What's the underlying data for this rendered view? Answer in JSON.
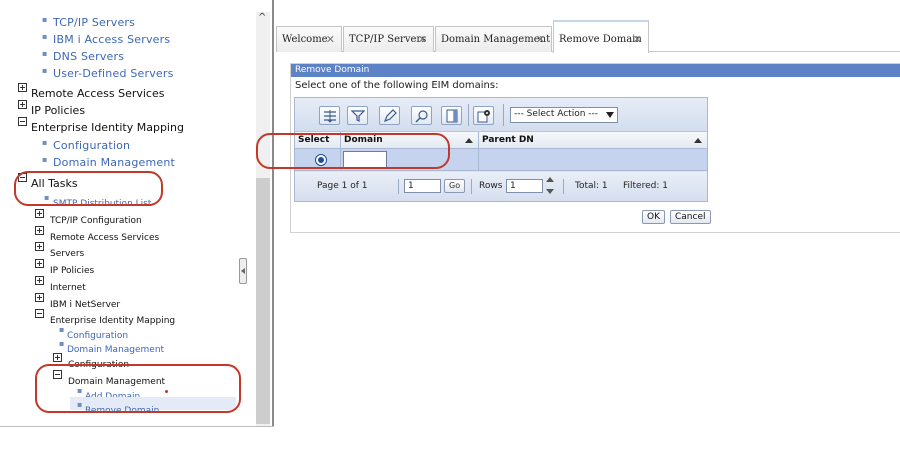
{
  "nav": {
    "items": [
      {
        "label": "TCP/IP Servers"
      },
      {
        "label": "IBM i Access Servers"
      },
      {
        "label": "DNS Servers"
      },
      {
        "label": "User-Defined Servers"
      },
      {
        "label": "Remote Access Services"
      },
      {
        "label": "IP Policies"
      },
      {
        "label": "Enterprise Identity Mapping"
      },
      {
        "label": "Configuration"
      },
      {
        "label": "Domain Management"
      },
      {
        "label": "All Tasks"
      },
      {
        "label": "SMTP Distribution List"
      },
      {
        "label": "TCP/IP Configuration"
      },
      {
        "label": "Remote Access Services"
      },
      {
        "label": "Servers"
      },
      {
        "label": "IP Policies"
      },
      {
        "label": "Internet"
      },
      {
        "label": "IBM i NetServer"
      },
      {
        "label": "Enterprise Identity Mapping"
      },
      {
        "label": "Configuration"
      },
      {
        "label": "Domain Management"
      },
      {
        "label": "Configuration"
      },
      {
        "label": "Domain Management"
      },
      {
        "label": "Add Domain"
      },
      {
        "label": "Remove Domain"
      }
    ]
  },
  "tabs": [
    {
      "label": "Welcome"
    },
    {
      "label": "TCP/IP Servers"
    },
    {
      "label": "Domain Management"
    },
    {
      "label": "Remove Domain"
    }
  ],
  "panel": {
    "title": "Remove Domain",
    "prompt": "Select one of the following EIM domains:"
  },
  "toolbar": {
    "icons": [
      "expand-rows-icon",
      "filter-icon",
      "edit-icon",
      "find-icon",
      "columns-icon",
      "settings-icon"
    ],
    "select_action": "--- Select Action ---"
  },
  "grid": {
    "columns": [
      "Select",
      "Domain",
      "Parent DN"
    ],
    "rows": [
      {
        "selected": true,
        "domain": "",
        "parent_dn": ""
      }
    ]
  },
  "footer": {
    "page_label": "Page 1 of 1",
    "page_value": "1",
    "go": "Go",
    "rows_label": "Rows",
    "rows_value": "1",
    "total": "Total: 1",
    "filtered": "Filtered: 1"
  },
  "buttons": {
    "ok": "OK",
    "cancel": "Cancel"
  },
  "colors": {
    "link": "#3d67b7",
    "panel_title_bg": "#5d82c5",
    "annotation": "#c0392b"
  }
}
